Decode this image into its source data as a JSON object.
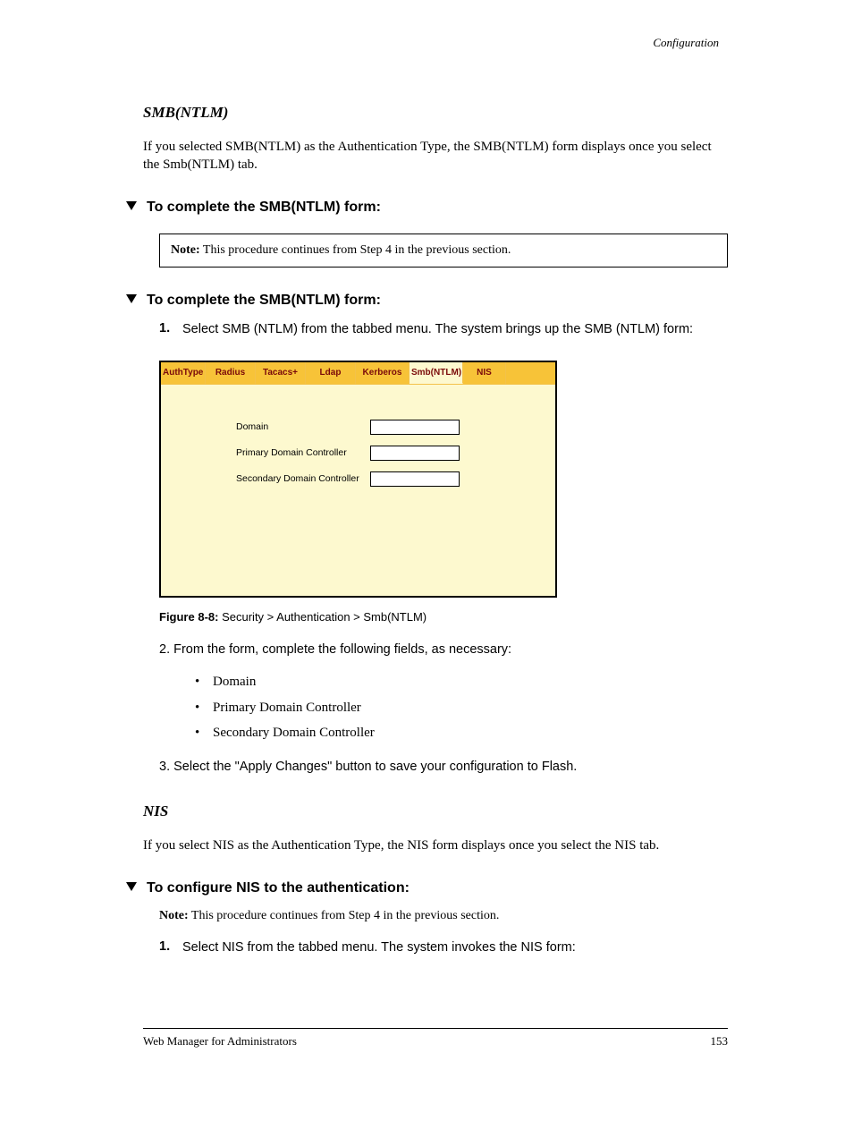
{
  "header": {
    "crumb": "Configuration"
  },
  "sections": {
    "smb_title": "SMB(NTLM)",
    "nis_title": "NIS"
  },
  "paras": {
    "p1": "If you selected SMB(NTLM) as the Authentication Type, the SMB(NTLM) form displays once you select the Smb(NTLM) tab.",
    "p2": "If you select NIS as the Authentication Type, the NIS form displays once you select the NIS tab."
  },
  "procs": {
    "complete_smb": "To complete the SMB(NTLM) form:",
    "configure_nis": "To configure NIS to the authentication:"
  },
  "steps": {
    "smb1": "Select SMB (NTLM) from the tabbed menu. The system brings up the SMB (NTLM) form:",
    "nis1": "Select NIS from the tabbed menu. The system invokes the NIS form:"
  },
  "note": {
    "label": "Note:",
    "text": "This procedure continues from Step 4 in the previous section."
  },
  "figure": {
    "number": "Figure 8-8:",
    "caption": "Security > Authentication > Smb(NTLM)"
  },
  "panel": {
    "tabs": {
      "authtype": "AuthType",
      "radius": "Radius",
      "tacacs": "Tacacs+",
      "ldap": "Ldap",
      "kerberos": "Kerberos",
      "smb": "Smb(NTLM)",
      "nis": "NIS"
    },
    "form": {
      "domain_label": "Domain",
      "pdc_label": "Primary Domain Controller",
      "sdc_label": "Secondary Domain Controller",
      "domain_value": "",
      "pdc_value": "",
      "sdc_value": ""
    }
  },
  "postfig": {
    "intro": "2. From the form, complete the following fields, as necessary:",
    "items": {
      "a": "Domain",
      "b": "Primary Domain Controller",
      "c": "Secondary Domain Controller"
    },
    "step3": "3. Select the \"Apply Changes\" button to save your configuration to Flash.",
    "note_label": "Note:",
    "note_text": "This procedure continues from Step 4 in the previous section."
  },
  "footer": {
    "left": "Web Manager for Administrators",
    "right": "153"
  }
}
